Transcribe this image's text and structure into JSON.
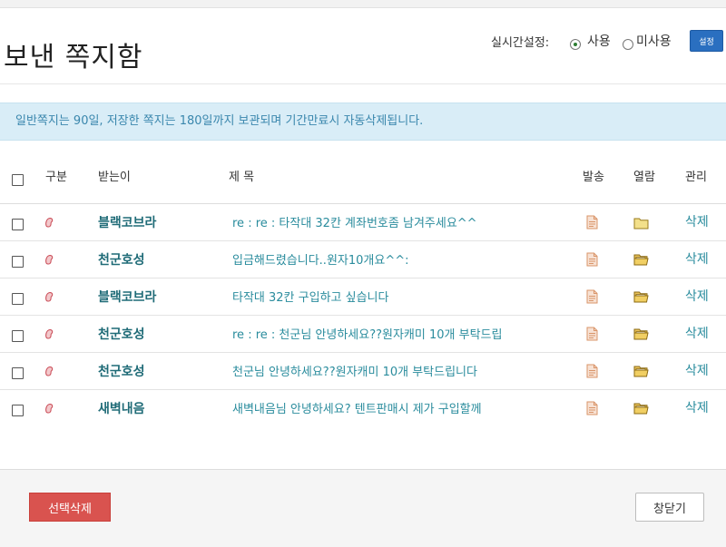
{
  "page": {
    "title": "보낸 쪽지함"
  },
  "realtime": {
    "label": "실시간설정:",
    "options": [
      "사용",
      "미사용"
    ],
    "selected": "사용",
    "button_label": "설정"
  },
  "notice": "일반쪽지는 90일, 저장한 쪽지는 180일까지 보관되며 기간만료시 자동삭제됩니다.",
  "table": {
    "headers": {
      "type": "구분",
      "recipient": "받는이",
      "subject": "제 목",
      "sent": "발송",
      "read": "열람",
      "manage": "관리"
    },
    "rows": [
      {
        "recipient": "블랙코브라",
        "subject": "re : re : 타작대 32칸 계좌번호좀 남겨주세요^^",
        "read_state": "unread",
        "action": "삭제"
      },
      {
        "recipient": "천군호성",
        "subject": "입금해드렸습니다..원자10개요^^:",
        "read_state": "read",
        "action": "삭제"
      },
      {
        "recipient": "블랙코브라",
        "subject": "타작대 32칸 구입하고 싶습니다",
        "read_state": "read",
        "action": "삭제"
      },
      {
        "recipient": "천군호성",
        "subject": "re : re : 천군님 안녕하세요??원자캐미 10개 부탁드립",
        "read_state": "read",
        "action": "삭제"
      },
      {
        "recipient": "천군호성",
        "subject": "천군님 안녕하세요??원자캐미 10개 부탁드립니다",
        "read_state": "read",
        "action": "삭제"
      },
      {
        "recipient": "새벽내음",
        "subject": "새벽내음님 안녕하세요? 텐트판매시 제가 구입할께",
        "read_state": "read",
        "action": "삭제"
      }
    ]
  },
  "footer": {
    "delete_selected": "선택삭제",
    "close_window": "창닫기"
  },
  "colors": {
    "accent": "#2a8c9d",
    "danger": "#d9534f",
    "notice_bg": "#d9edf7",
    "button_blue": "#2a6fc0"
  }
}
